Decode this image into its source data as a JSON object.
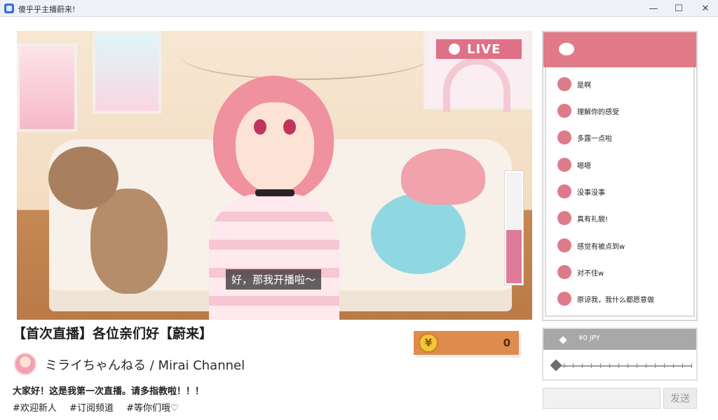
{
  "window": {
    "title": "傻乎乎主播蔚来!",
    "minimize": "—",
    "maximize": "☐",
    "close": "✕"
  },
  "video": {
    "live_badge": "LIVE",
    "subtitle": "好，那我开播啦～",
    "meter_level": 0.48
  },
  "stream": {
    "title": "【首次直播】各位亲们好【蔚来】",
    "channel": "ミライちゃんねる / Mirai Channel",
    "description": "大家好！这是我第一次直播。请多指教啦！！！",
    "tags": [
      "#欢迎新人",
      "#订阅频道",
      "#等你们哦♡"
    ]
  },
  "coins": {
    "icon_glyph": "¥",
    "value": "0"
  },
  "chat": {
    "icon": "chat-bubble-icon",
    "messages": [
      "是啊",
      "理解你的感受",
      "多露一点啦",
      "嗯嗯",
      "没事没事",
      "真有礼貌!",
      "感觉有被点到w",
      "对不住w",
      "原谅我，我什么都愿意做"
    ]
  },
  "tip": {
    "amount": "¥0 JPY",
    "slider_value": 0
  },
  "input": {
    "value": "",
    "send_label": "发送"
  },
  "colors": {
    "accent_pink": "#e17a87",
    "coin_orange": "#e08a4d"
  }
}
